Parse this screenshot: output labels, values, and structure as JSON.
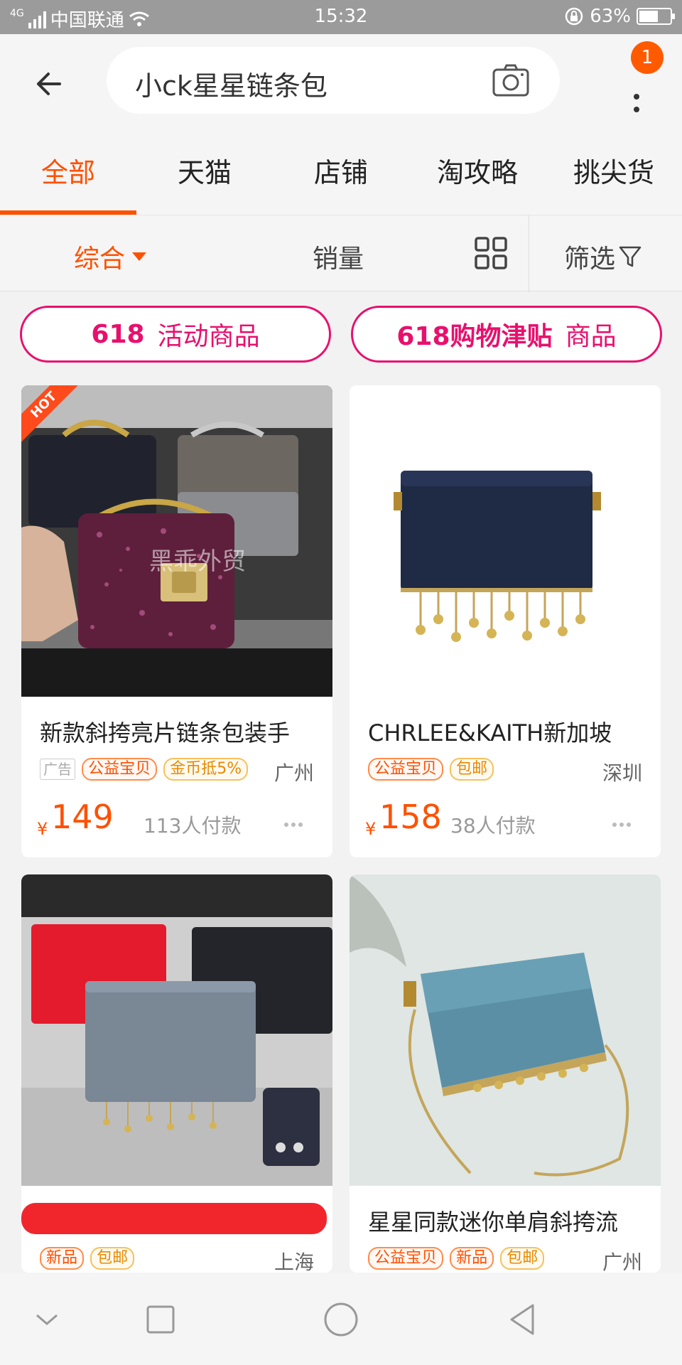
{
  "status_bar": {
    "network": "4G",
    "carrier": "中国联通",
    "time": "15:32",
    "battery_percent": "63%",
    "battery_level": 0.63
  },
  "search": {
    "query": "小ck星星链条包",
    "notification_count": "1"
  },
  "tabs": [
    {
      "label": "全部",
      "active": true
    },
    {
      "label": "天猫",
      "active": false
    },
    {
      "label": "店铺",
      "active": false
    },
    {
      "label": "淘攻略",
      "active": false
    },
    {
      "label": "挑尖货",
      "active": false
    }
  ],
  "sort": {
    "comprehensive": "综合",
    "sales": "销量",
    "filter": "筛选"
  },
  "promos": [
    {
      "bold": "618",
      "normal": "活动商品"
    },
    {
      "bold": "618购物津贴",
      "normal": "商品"
    }
  ],
  "products": [
    {
      "title": "新款斜挎亮片链条包装手",
      "ad_label": "广告",
      "tags": [
        "公益宝贝",
        "金币抵5%"
      ],
      "location": "广州",
      "currency": "¥",
      "price": "149",
      "sold": "113人付款",
      "hot": "HOT",
      "watermark": "黑乖外贸"
    },
    {
      "title": "CHRLEE&KAITH新加坡",
      "tags": [
        "公益宝贝",
        "包邮"
      ],
      "location": "深圳",
      "currency": "¥",
      "price": "158",
      "sold": "38人付款"
    },
    {
      "title": "",
      "tags": [
        "新品",
        "包邮"
      ],
      "location": "上海"
    },
    {
      "title": "星星同款迷你单肩斜挎流",
      "tags": [
        "公益宝贝",
        "新品",
        "包邮"
      ],
      "location": "广州"
    }
  ],
  "colors": {
    "accent": "#ff5000",
    "promo": "#e8106d",
    "status_bar": "#9b9b9b"
  }
}
